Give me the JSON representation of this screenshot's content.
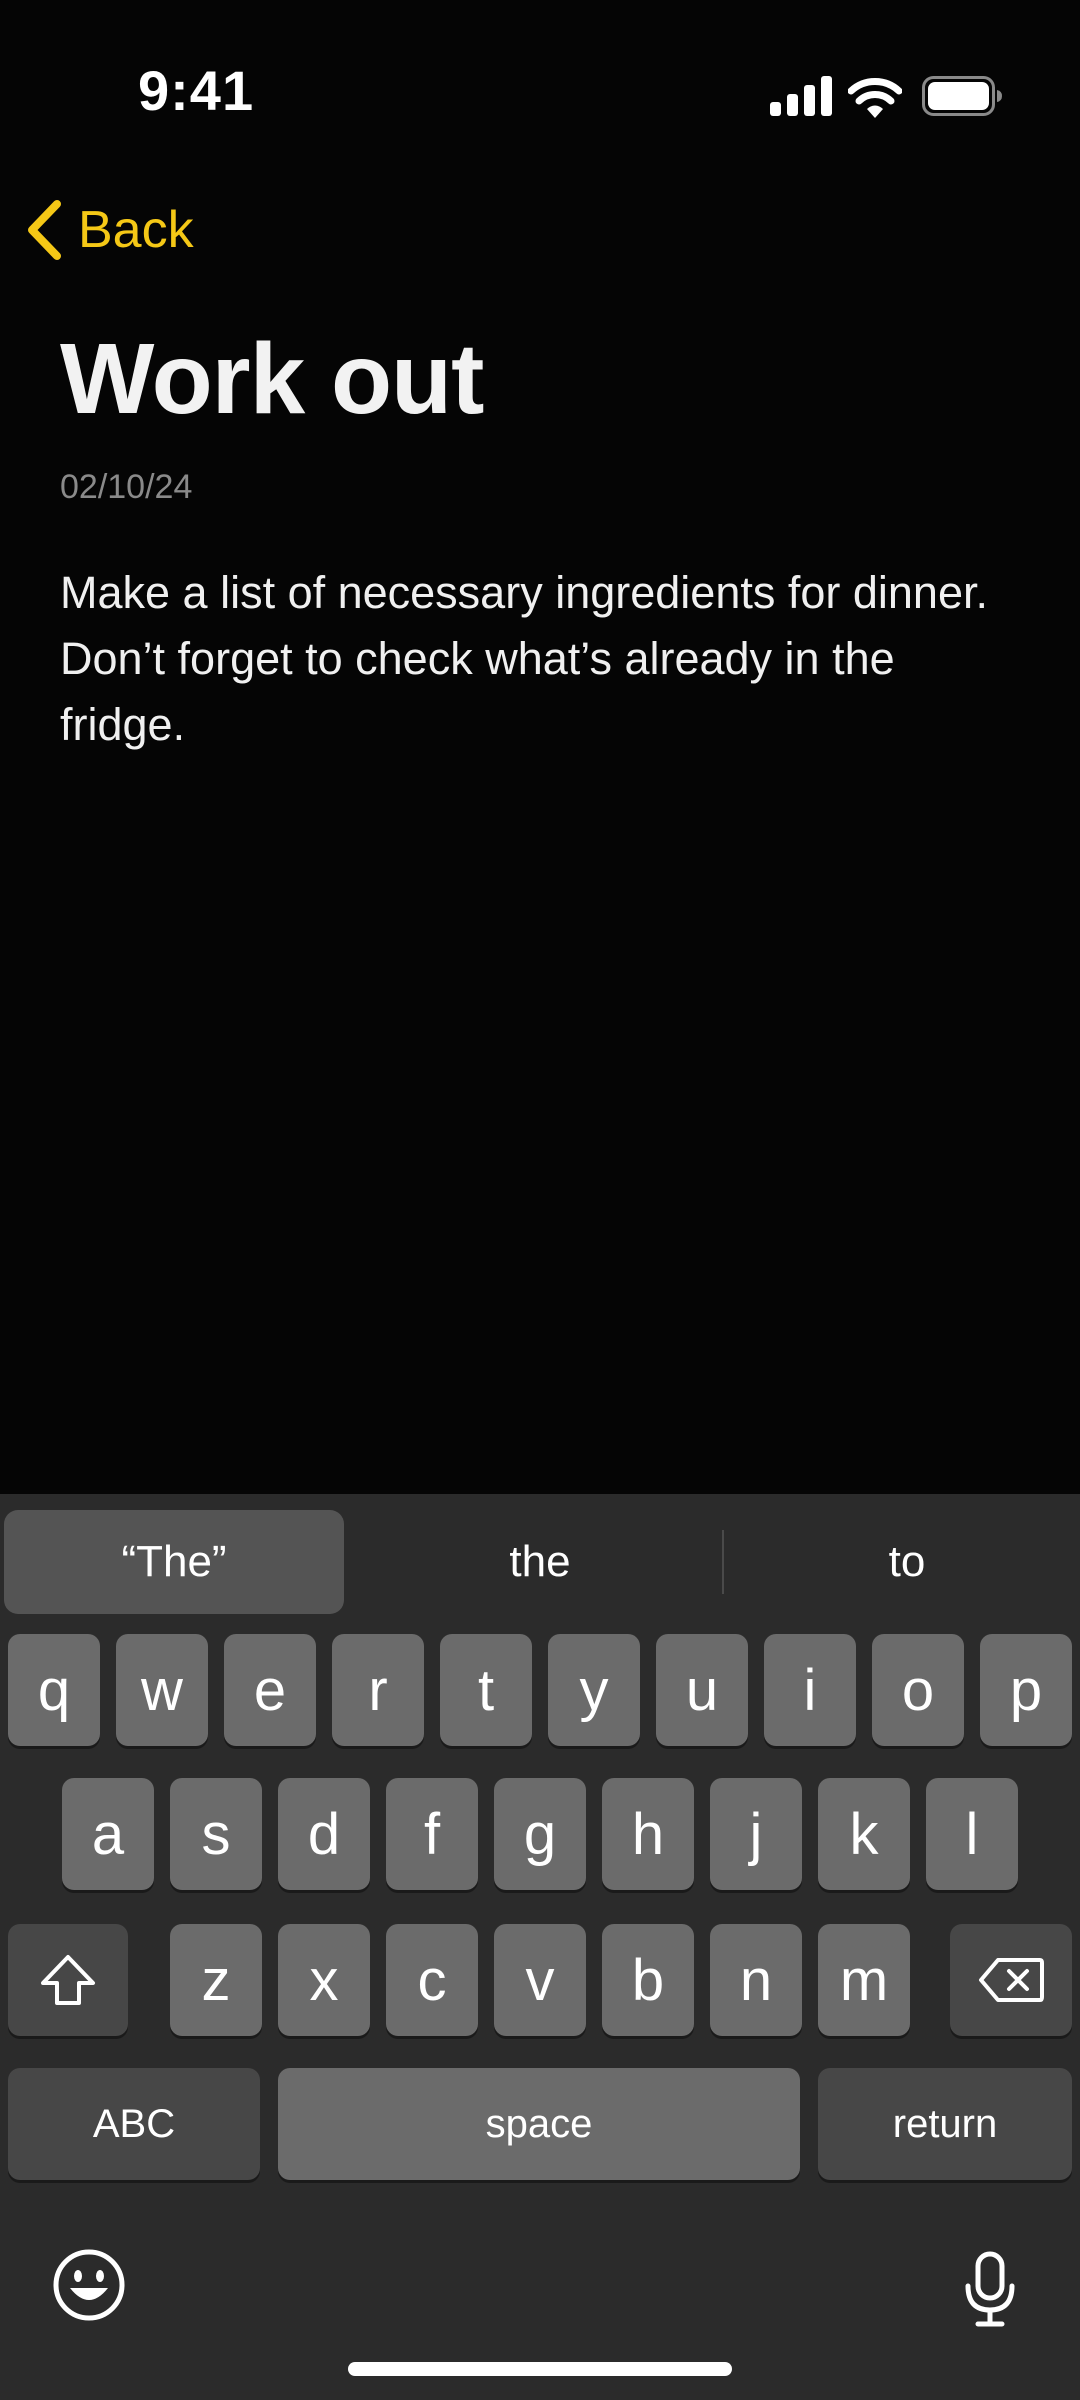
{
  "status_bar": {
    "time": "9:41"
  },
  "nav": {
    "back_label": "Back",
    "accent_color": "#f5c816"
  },
  "note": {
    "title": "Work out",
    "date": "02/10/24",
    "body": "Make a list of necessary ingredients for dinner. Don’t forget to check what’s already in the fridge."
  },
  "keyboard": {
    "suggestions": [
      "“The”",
      "the",
      "to"
    ],
    "row1": [
      "q",
      "w",
      "e",
      "r",
      "t",
      "y",
      "u",
      "i",
      "o",
      "p"
    ],
    "row2": [
      "a",
      "s",
      "d",
      "f",
      "g",
      "h",
      "j",
      "k",
      "l"
    ],
    "row3": [
      "z",
      "x",
      "c",
      "v",
      "b",
      "n",
      "m"
    ],
    "abc_label": "ABC",
    "space_label": "space",
    "return_label": "return"
  }
}
